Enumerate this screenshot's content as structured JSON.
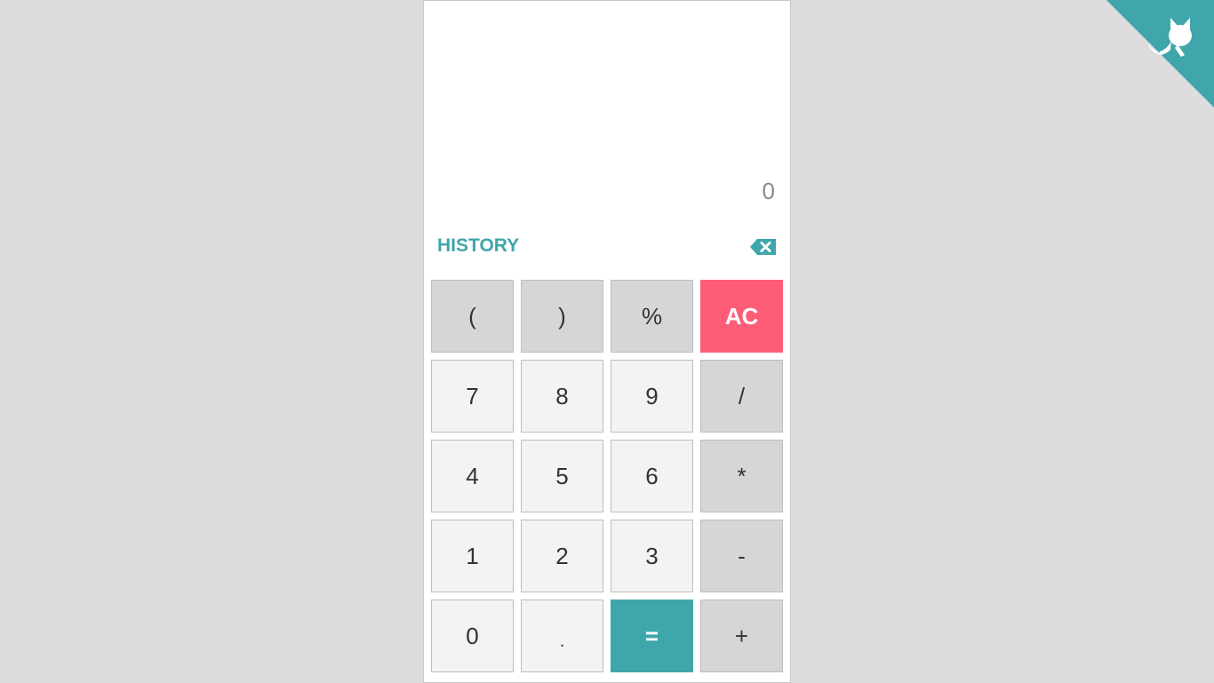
{
  "display": {
    "value": "0"
  },
  "history": {
    "label": "HISTORY"
  },
  "icons": {
    "backspace": "backspace-icon",
    "corner": "octocat-icon"
  },
  "colors": {
    "accent": "#3fa6ab",
    "clear": "#ff5c78",
    "operator_key": "#d6d6d6",
    "digit_key": "#f3f3f3",
    "background": "#dddddd"
  },
  "keys": [
    {
      "label": "(",
      "type": "op",
      "name": "open-paren-key"
    },
    {
      "label": ")",
      "type": "op",
      "name": "close-paren-key"
    },
    {
      "label": "%",
      "type": "op",
      "name": "percent-key"
    },
    {
      "label": "AC",
      "type": "ac",
      "name": "all-clear-key"
    },
    {
      "label": "7",
      "type": "digit",
      "name": "digit-7-key"
    },
    {
      "label": "8",
      "type": "digit",
      "name": "digit-8-key"
    },
    {
      "label": "9",
      "type": "digit",
      "name": "digit-9-key"
    },
    {
      "label": "/",
      "type": "op",
      "name": "divide-key"
    },
    {
      "label": "4",
      "type": "digit",
      "name": "digit-4-key"
    },
    {
      "label": "5",
      "type": "digit",
      "name": "digit-5-key"
    },
    {
      "label": "6",
      "type": "digit",
      "name": "digit-6-key"
    },
    {
      "label": "*",
      "type": "op",
      "name": "multiply-key"
    },
    {
      "label": "1",
      "type": "digit",
      "name": "digit-1-key"
    },
    {
      "label": "2",
      "type": "digit",
      "name": "digit-2-key"
    },
    {
      "label": "3",
      "type": "digit",
      "name": "digit-3-key"
    },
    {
      "label": "-",
      "type": "op",
      "name": "subtract-key"
    },
    {
      "label": "0",
      "type": "digit",
      "name": "digit-0-key"
    },
    {
      "label": ".",
      "type": "dot",
      "name": "decimal-key"
    },
    {
      "label": "=",
      "type": "eq",
      "name": "equals-key"
    },
    {
      "label": "+",
      "type": "op",
      "name": "add-key"
    }
  ]
}
